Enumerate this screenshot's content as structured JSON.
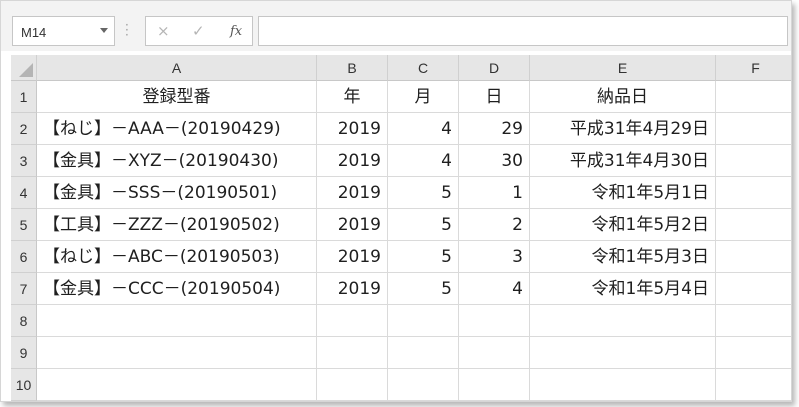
{
  "name_box": {
    "value": "M14"
  },
  "formula_bar": {
    "cancel_icon": "×",
    "enter_icon": "✓",
    "fx_label": "fx",
    "formula": ""
  },
  "columns": [
    "A",
    "B",
    "C",
    "D",
    "E",
    "F"
  ],
  "row_numbers": [
    "1",
    "2",
    "3",
    "4",
    "5",
    "6",
    "7",
    "8",
    "9",
    "10"
  ],
  "header": {
    "a": "登録型番",
    "b": "年",
    "c": "月",
    "d": "日",
    "e": "納品日",
    "f": ""
  },
  "rows": [
    {
      "a": "【ねじ】－AAA－(20190429)",
      "b": "2019",
      "c": "4",
      "d": "29",
      "e": "平成31年4月29日",
      "f": ""
    },
    {
      "a": "【金具】－XYZ－(20190430)",
      "b": "2019",
      "c": "4",
      "d": "30",
      "e": "平成31年4月30日",
      "f": ""
    },
    {
      "a": "【金具】－SSS－(20190501)",
      "b": "2019",
      "c": "5",
      "d": "1",
      "e": "令和1年5月1日",
      "f": ""
    },
    {
      "a": "【工具】－ZZZ－(20190502)",
      "b": "2019",
      "c": "5",
      "d": "2",
      "e": "令和1年5月2日",
      "f": ""
    },
    {
      "a": "【ねじ】－ABC－(20190503)",
      "b": "2019",
      "c": "5",
      "d": "3",
      "e": "令和1年5月3日",
      "f": ""
    },
    {
      "a": "【金具】－CCC－(20190504)",
      "b": "2019",
      "c": "5",
      "d": "4",
      "e": "令和1年5月4日",
      "f": ""
    },
    {
      "a": "",
      "b": "",
      "c": "",
      "d": "",
      "e": "",
      "f": ""
    },
    {
      "a": "",
      "b": "",
      "c": "",
      "d": "",
      "e": "",
      "f": ""
    },
    {
      "a": "",
      "b": "",
      "c": "",
      "d": "",
      "e": "",
      "f": ""
    }
  ]
}
